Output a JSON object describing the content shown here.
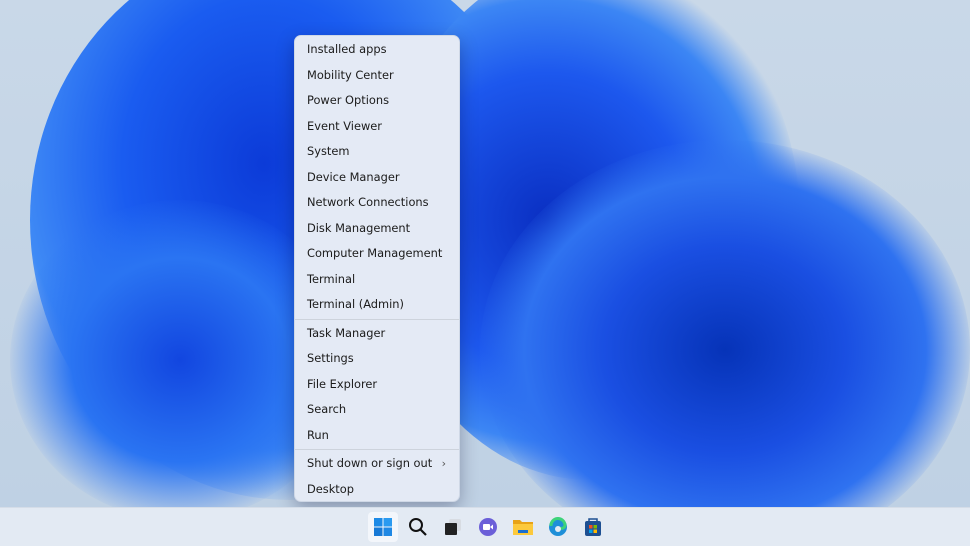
{
  "menu": {
    "group1": [
      "Installed apps",
      "Mobility Center",
      "Power Options",
      "Event Viewer",
      "System",
      "Device Manager",
      "Network Connections",
      "Disk Management",
      "Computer Management",
      "Terminal",
      "Terminal (Admin)"
    ],
    "group2": [
      "Task Manager",
      "Settings",
      "File Explorer",
      "Search",
      "Run"
    ],
    "group3": [
      "Shut down or sign out",
      "Desktop"
    ],
    "submenu_chevron": "›"
  },
  "taskbar": {
    "icons": [
      "start-icon",
      "search-icon",
      "task-view-icon",
      "teams-chat-icon",
      "file-explorer-icon",
      "edge-icon",
      "store-icon"
    ]
  }
}
